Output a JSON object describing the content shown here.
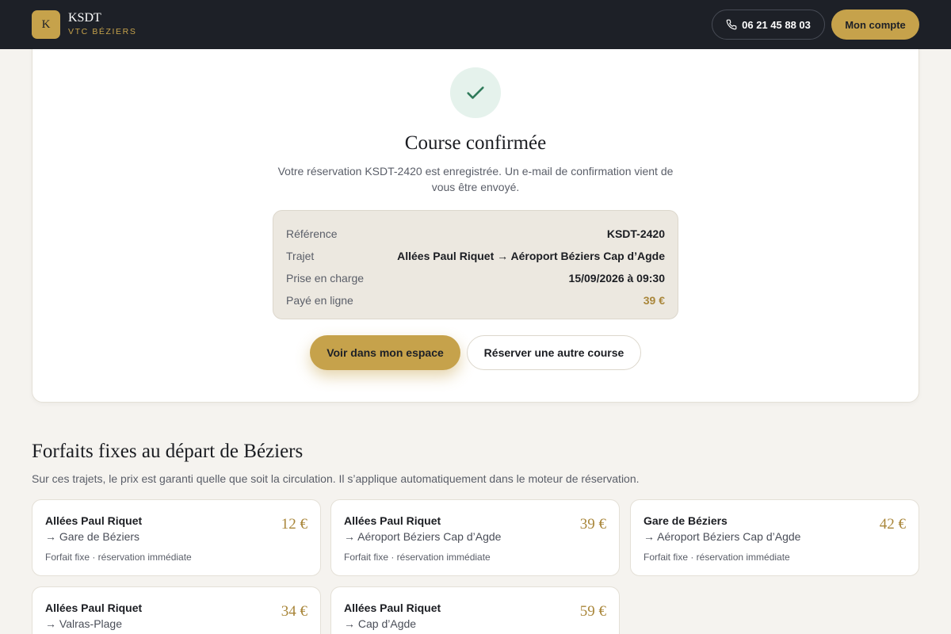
{
  "header": {
    "logo_letter": "K",
    "brand_name": "KSDT",
    "brand_sub": "VTC BÉZIERS",
    "phone": "06 21 45 88 03",
    "account_label": "Mon compte"
  },
  "confirmation": {
    "title": "Course confirmée",
    "message": "Votre réservation KSDT-2420 est enregistrée. Un e-mail de confirmation vient de vous être envoyé.",
    "summary": [
      {
        "label": "Référence",
        "value": "KSDT-2420"
      },
      {
        "label": "Trajet",
        "value": "Allées Paul Riquet → Aéroport Béziers Cap d’Agde"
      },
      {
        "label": "Prise en charge",
        "value": "15/09/2026 à 09:30"
      },
      {
        "label": "Payé en ligne",
        "value": "39 €"
      }
    ],
    "primary_button": "Voir dans mon espace",
    "secondary_button": "Réserver une autre course"
  },
  "forfaits": {
    "title": "Forfaits fixes au départ de Béziers",
    "subtitle": "Sur ces trajets, le prix est garanti quelle que soit la circulation. Il s’applique automatiquement dans le moteur de réservation.",
    "cards": [
      {
        "from": "Allées Paul Riquet",
        "to": "→ Gare de Béziers",
        "meta": "Forfait fixe · réservation immédiate",
        "price": "12 €"
      },
      {
        "from": "Allées Paul Riquet",
        "to": "→ Aéroport Béziers Cap d’Agde",
        "meta": "Forfait fixe · réservation immédiate",
        "price": "39 €"
      },
      {
        "from": "Gare de Béziers",
        "to": "→ Aéroport Béziers Cap d’Agde",
        "meta": "Forfait fixe · réservation immédiate",
        "price": "42 €"
      },
      {
        "from": "Allées Paul Riquet",
        "to": "→ Valras-Plage",
        "meta": "",
        "price": "34 €"
      },
      {
        "from": "Allées Paul Riquet",
        "to": "→ Cap d’Agde",
        "meta": "",
        "price": "59 €"
      }
    ]
  },
  "colors": {
    "gold": "#c6a24b",
    "header_bg": "#1d2027",
    "success": "#2f7a5a"
  },
  "icons": [
    "phone-icon",
    "check-icon"
  ]
}
